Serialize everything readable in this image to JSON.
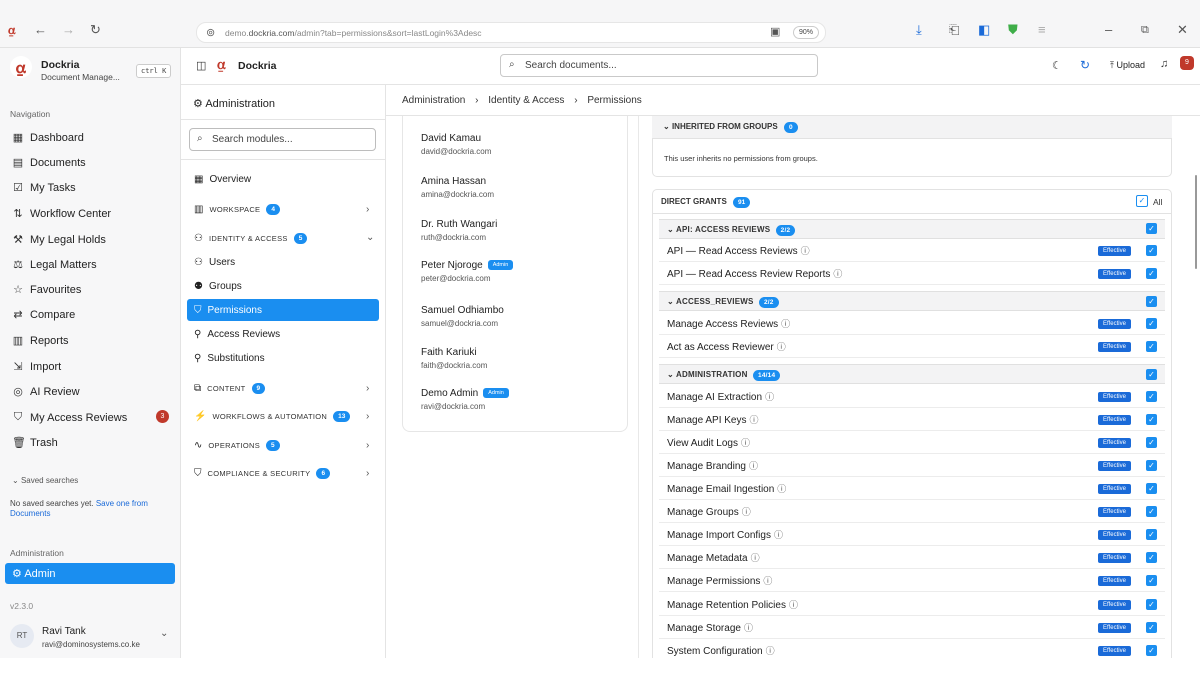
{
  "browser": {
    "url_prefix": "demo.",
    "url_domain": "dockria.com",
    "url_rest": "/admin?tab=permissions&sort=lastLogin%3Adesc",
    "zoom": "90%"
  },
  "sidebar": {
    "app_name": "Dockria",
    "app_subtitle": "Document Manage...",
    "shortcut": "ctrl K",
    "nav_heading": "Navigation",
    "items": [
      {
        "label": "Dashboard",
        "icon": "dashboard-icon"
      },
      {
        "label": "Documents",
        "icon": "document-icon"
      },
      {
        "label": "My Tasks",
        "icon": "tasks-icon"
      },
      {
        "label": "Workflow Center",
        "icon": "workflow-icon"
      },
      {
        "label": "My Legal Holds",
        "icon": "gavel-icon"
      },
      {
        "label": "Legal Matters",
        "icon": "scale-icon"
      },
      {
        "label": "Favourites",
        "icon": "star-icon"
      },
      {
        "label": "Compare",
        "icon": "compare-icon"
      },
      {
        "label": "Reports",
        "icon": "chart-icon"
      },
      {
        "label": "Import",
        "icon": "import-icon"
      },
      {
        "label": "AI Review",
        "icon": "ai-icon"
      },
      {
        "label": "My Access Reviews",
        "icon": "shield-check-icon",
        "badge": "3"
      },
      {
        "label": "Trash",
        "icon": "trash-icon"
      }
    ],
    "saved_searches_label": "Saved searches",
    "saved_searches_empty": "No saved searches yet.",
    "saved_searches_link": "Save one from Documents",
    "admin_heading": "Administration",
    "admin_item": "Admin",
    "version": "v2.3.0",
    "user_initials": "RT",
    "user_name": "Ravi Tank",
    "user_email": "ravi@dominosystems.co.ke"
  },
  "topbar": {
    "brand": "Dockria",
    "search_placeholder": "Search documents...",
    "upload_label": "Upload",
    "notif_count": "9"
  },
  "modules": {
    "title": "Administration",
    "search_placeholder": "Search modules...",
    "overview": "Overview",
    "workspace": "WORKSPACE",
    "workspace_count": "4",
    "identity": "IDENTITY & ACCESS",
    "identity_count": "5",
    "users": "Users",
    "groups": "Groups",
    "permissions": "Permissions",
    "access_reviews": "Access Reviews",
    "substitutions": "Substitutions",
    "content": "CONTENT",
    "content_count": "9",
    "workflows": "WORKFLOWS & AUTOMATION",
    "workflows_count": "13",
    "operations": "OPERATIONS",
    "operations_count": "5",
    "compliance": "COMPLIANCE & SECURITY",
    "compliance_count": "6"
  },
  "breadcrumb": [
    "Administration",
    "Identity & Access",
    "Permissions"
  ],
  "users": [
    {
      "name": "David Kamau",
      "email": "david@dockria.com",
      "badge": ""
    },
    {
      "name": "Amina Hassan",
      "email": "amina@dockria.com",
      "badge": ""
    },
    {
      "name": "Dr. Ruth Wangari",
      "email": "ruth@dockria.com",
      "badge": ""
    },
    {
      "name": "Peter Njoroge",
      "email": "peter@dockria.com",
      "badge": "Admin"
    },
    {
      "name": "Samuel Odhiambo",
      "email": "samuel@dockria.com",
      "badge": ""
    },
    {
      "name": "Faith Kariuki",
      "email": "faith@dockria.com",
      "badge": ""
    },
    {
      "name": "Demo Admin",
      "email": "ravi@dockria.com",
      "badge": "Admin"
    }
  ],
  "inherited": {
    "title": "INHERITED FROM GROUPS",
    "count": "0",
    "text": "This user inherits no permissions from groups."
  },
  "direct": {
    "title": "DIRECT GRANTS",
    "count": "91",
    "all_label": "All",
    "effective_label": "Effective",
    "sections": [
      {
        "title": "API: ACCESS REVIEWS",
        "count": "2/2",
        "perms": [
          "API — Read Access Reviews",
          "API — Read Access Review Reports"
        ]
      },
      {
        "title": "ACCESS_REVIEWS",
        "count": "2/2",
        "perms": [
          "Manage Access Reviews",
          "Act as Access Reviewer"
        ]
      },
      {
        "title": "ADMINISTRATION",
        "count": "14/14",
        "perms": [
          "Manage AI Extraction",
          "Manage API Keys",
          "View Audit Logs",
          "Manage Branding",
          "Manage Email Ingestion",
          "Manage Groups",
          "Manage Import Configs",
          "Manage Metadata",
          "Manage Permissions",
          "Manage Retention Policies",
          "Manage Storage",
          "System Configuration"
        ]
      }
    ]
  }
}
